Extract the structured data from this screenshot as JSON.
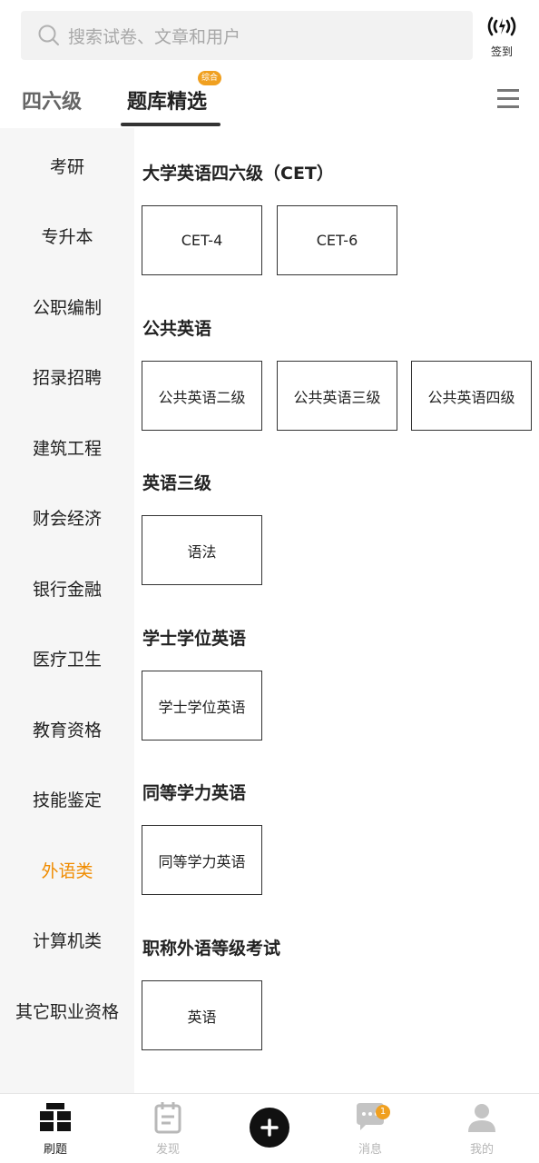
{
  "search": {
    "placeholder": "搜索试卷、文章和用户",
    "icon": "search-icon"
  },
  "signin": {
    "label": "签到",
    "icon": "signal-icon"
  },
  "tabs": [
    {
      "label": "四六级"
    },
    {
      "label": "题库精选",
      "badge": "综合",
      "active": true
    }
  ],
  "sidebar": {
    "items": [
      {
        "label": "考研"
      },
      {
        "label": "专升本"
      },
      {
        "label": "公职编制"
      },
      {
        "label": "招录招聘"
      },
      {
        "label": "建筑工程"
      },
      {
        "label": "财会经济"
      },
      {
        "label": "银行金融"
      },
      {
        "label": "医疗卫生"
      },
      {
        "label": "教育资格"
      },
      {
        "label": "技能鉴定"
      },
      {
        "label": "外语类",
        "active": true
      },
      {
        "label": "计算机类"
      },
      {
        "label": "其它职业资格"
      }
    ]
  },
  "sections": [
    {
      "title": "大学英语四六级（CET）",
      "items": [
        "CET-4",
        "CET-6"
      ]
    },
    {
      "title": "公共英语",
      "items": [
        "公共英语二级",
        "公共英语三级",
        "公共英语四级"
      ]
    },
    {
      "title": "英语三级",
      "items": [
        "语法"
      ]
    },
    {
      "title": "学士学位英语",
      "items": [
        "学士学位英语"
      ]
    },
    {
      "title": "同等学力英语",
      "items": [
        "同等学力英语"
      ]
    },
    {
      "title": "职称外语等级考试",
      "items": [
        "英语"
      ]
    }
  ],
  "bottom_nav": {
    "items": [
      {
        "label": "刷题",
        "icon": "question-bank-icon",
        "active": true
      },
      {
        "label": "发现",
        "icon": "calendar-icon"
      },
      {
        "label": "",
        "icon": "plus-icon"
      },
      {
        "label": "消息",
        "icon": "message-icon",
        "badge": "1"
      },
      {
        "label": "我的",
        "icon": "user-icon"
      }
    ]
  },
  "colors": {
    "accent": "#f08c00",
    "badge": "#f0a020",
    "sidebar_bg": "#f6f6f6",
    "search_bg": "#f2f2f2"
  }
}
